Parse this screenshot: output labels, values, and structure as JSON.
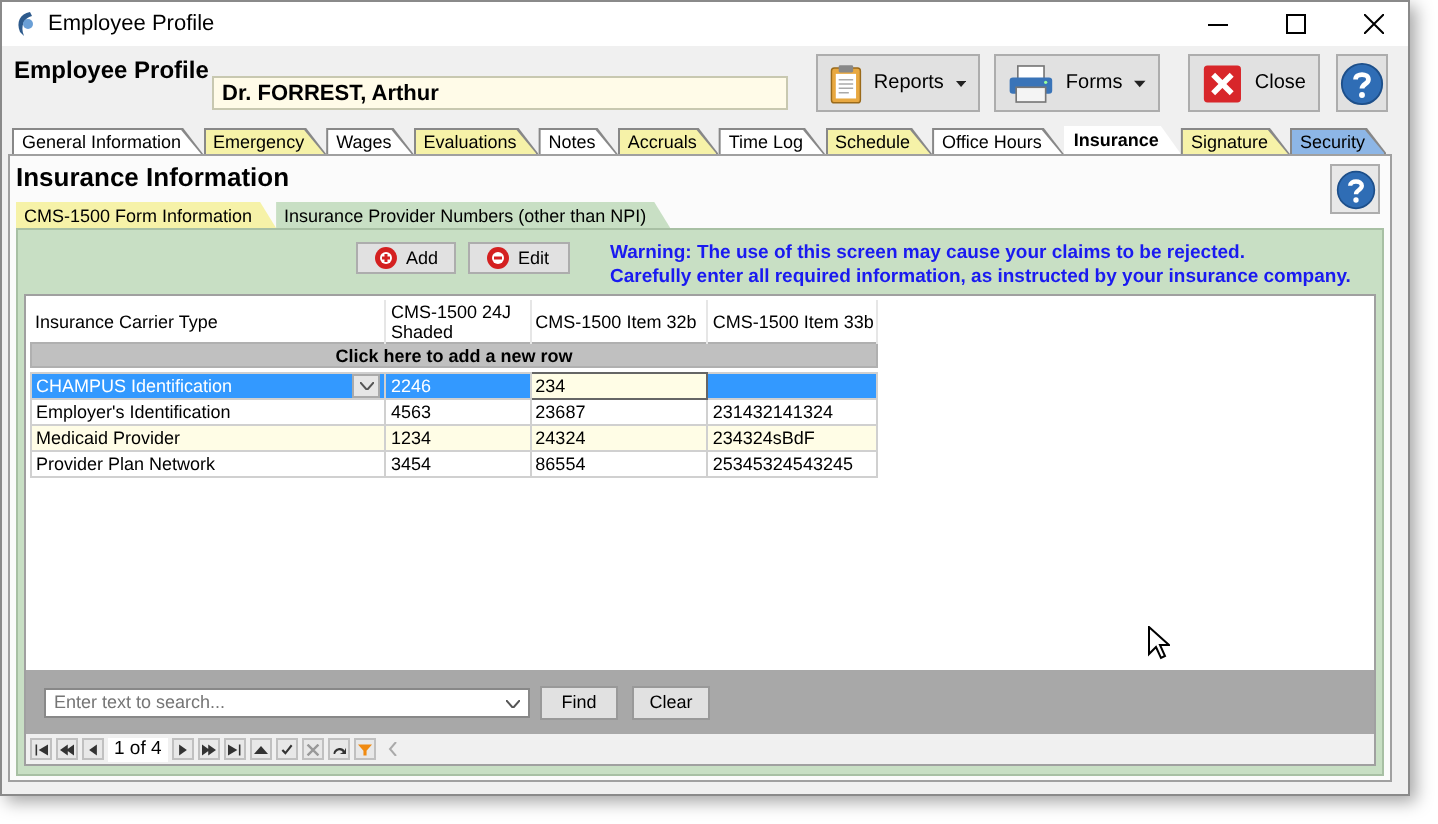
{
  "window": {
    "title": "Employee Profile"
  },
  "header": {
    "title": "Employee Profile",
    "name": "Dr. FORREST, Arthur",
    "buttons": [
      {
        "label": "Reports",
        "kind": "reports",
        "dropdown": true
      },
      {
        "label": "Forms",
        "kind": "forms",
        "dropdown": true
      },
      {
        "label": "Close",
        "kind": "close",
        "dropdown": false
      }
    ]
  },
  "tabs": [
    {
      "label": "General Information",
      "selected": false,
      "color": "#ffffff"
    },
    {
      "label": "Emergency",
      "selected": false,
      "color": "#f6f2a8"
    },
    {
      "label": "Wages",
      "selected": false,
      "color": "#ffffff"
    },
    {
      "label": "Evaluations",
      "selected": false,
      "color": "#f6f2a8"
    },
    {
      "label": "Notes",
      "selected": false,
      "color": "#ffffff"
    },
    {
      "label": "Accruals",
      "selected": false,
      "color": "#f6f2a8"
    },
    {
      "label": "Time Log",
      "selected": false,
      "color": "#ffffff"
    },
    {
      "label": "Schedule",
      "selected": false,
      "color": "#f6f2a8"
    },
    {
      "label": "Office Hours",
      "selected": false,
      "color": "#ffffff"
    },
    {
      "label": "Insurance",
      "selected": true,
      "color": "#ffffff"
    },
    {
      "label": "Signature",
      "selected": false,
      "color": "#f6f2a8"
    },
    {
      "label": "Security",
      "selected": false,
      "color": "#8db6e6"
    }
  ],
  "section_title": "Insurance Information",
  "subtabs": [
    {
      "label": "CMS-1500 Form Information",
      "selected": false
    },
    {
      "label": "Insurance Provider Numbers (other than NPI)",
      "selected": true
    }
  ],
  "actions": [
    {
      "label": "Add",
      "kind": "add"
    },
    {
      "label": "Edit",
      "kind": "edit"
    }
  ],
  "warning": [
    "Warning:  The use of this screen may cause your claims to be rejected.",
    "Carefully enter all required information, as instructed by your insurance company."
  ],
  "table": {
    "columns": [
      "Insurance Carrier Type",
      "CMS-1500 24J Shaded",
      "CMS-1500 Item 32b",
      "CMS-1500 Item 33b"
    ],
    "new_row": "Click here to add a new row",
    "rows": [
      {
        "cells": [
          "CHAMPUS Identification",
          "2246",
          "234"
        ],
        "selected": true,
        "editing": true
      },
      {
        "cells": [
          "Employer's Identification",
          "4563",
          "23687",
          "231432141324"
        ],
        "selected": false,
        "editing": false
      },
      {
        "cells": [
          "Medicaid Provider",
          "1234",
          "24324",
          "234324sBdF"
        ],
        "selected": false,
        "editing": false
      },
      {
        "cells": [
          "Provider Plan Network",
          "3454",
          "86554",
          "25345324543245"
        ],
        "selected": false,
        "editing": false
      }
    ]
  },
  "search": {
    "placeholder": "Enter text to search...",
    "buttons": [
      "Find",
      "Clear"
    ]
  },
  "navigator": {
    "position": "1 of 4"
  }
}
